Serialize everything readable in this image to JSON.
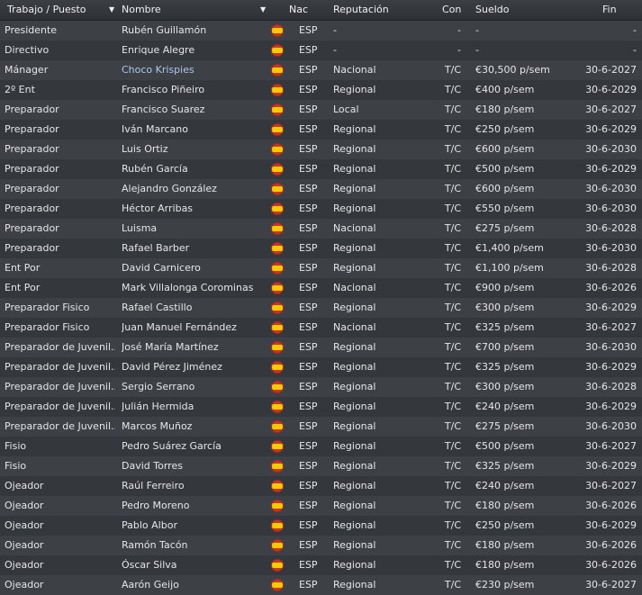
{
  "header": {
    "job": "Trabajo / Puesto",
    "name": "Nombre",
    "nac": "Nac",
    "rep": "Reputación",
    "con": "Con",
    "sal": "Sueldo",
    "fin": "Fin"
  },
  "rows": [
    {
      "job": "Presidente",
      "name": "Rubén Guillamón",
      "nac": "ESP",
      "rep": "-",
      "con": "-",
      "sal": "-",
      "fin": "-"
    },
    {
      "job": "Directivo",
      "name": "Enrique Alegre",
      "nac": "ESP",
      "rep": "-",
      "con": "-",
      "sal": "-",
      "fin": "-"
    },
    {
      "job": "Mánager",
      "name": "Choco Krispies",
      "nac": "ESP",
      "rep": "Nacional",
      "con": "T/C",
      "sal": "€30,500 p/sem",
      "fin": "30-6-2027",
      "link": true
    },
    {
      "job": "2º Ent",
      "name": "Francisco Piñeiro",
      "nac": "ESP",
      "rep": "Regional",
      "con": "T/C",
      "sal": "€400 p/sem",
      "fin": "30-6-2029"
    },
    {
      "job": "Preparador",
      "name": "Francisco Suarez",
      "nac": "ESP",
      "rep": "Local",
      "con": "T/C",
      "sal": "€180 p/sem",
      "fin": "30-6-2027"
    },
    {
      "job": "Preparador",
      "name": "Iván Marcano",
      "nac": "ESP",
      "rep": "Regional",
      "con": "T/C",
      "sal": "€250 p/sem",
      "fin": "30-6-2029"
    },
    {
      "job": "Preparador",
      "name": "Luis Ortiz",
      "nac": "ESP",
      "rep": "Regional",
      "con": "T/C",
      "sal": "€600 p/sem",
      "fin": "30-6-2030"
    },
    {
      "job": "Preparador",
      "name": "Rubén García",
      "nac": "ESP",
      "rep": "Regional",
      "con": "T/C",
      "sal": "€500 p/sem",
      "fin": "30-6-2029"
    },
    {
      "job": "Preparador",
      "name": "Alejandro González",
      "nac": "ESP",
      "rep": "Regional",
      "con": "T/C",
      "sal": "€600 p/sem",
      "fin": "30-6-2030"
    },
    {
      "job": "Preparador",
      "name": "Héctor Arribas",
      "nac": "ESP",
      "rep": "Regional",
      "con": "T/C",
      "sal": "€550 p/sem",
      "fin": "30-6-2030"
    },
    {
      "job": "Preparador",
      "name": "Luisma",
      "nac": "ESP",
      "rep": "Nacional",
      "con": "T/C",
      "sal": "€275 p/sem",
      "fin": "30-6-2028"
    },
    {
      "job": "Preparador",
      "name": "Rafael Barber",
      "nac": "ESP",
      "rep": "Regional",
      "con": "T/C",
      "sal": "€1,400 p/sem",
      "fin": "30-6-2030"
    },
    {
      "job": "Ent Por",
      "name": "David Carnicero",
      "nac": "ESP",
      "rep": "Regional",
      "con": "T/C",
      "sal": "€1,100 p/sem",
      "fin": "30-6-2028"
    },
    {
      "job": "Ent Por",
      "name": "Mark Villalonga Corominas",
      "nac": "ESP",
      "rep": "Nacional",
      "con": "T/C",
      "sal": "€900 p/sem",
      "fin": "30-6-2026"
    },
    {
      "job": "Preparador Fisico",
      "name": "Rafael Castillo",
      "nac": "ESP",
      "rep": "Regional",
      "con": "T/C",
      "sal": "€300 p/sem",
      "fin": "30-6-2029"
    },
    {
      "job": "Preparador Fisico",
      "name": "Juan Manuel Fernández",
      "nac": "ESP",
      "rep": "Nacional",
      "con": "T/C",
      "sal": "€325 p/sem",
      "fin": "30-6-2027"
    },
    {
      "job": "Preparador de Juvenil...",
      "name": "José María Martínez",
      "nac": "ESP",
      "rep": "Regional",
      "con": "T/C",
      "sal": "€700 p/sem",
      "fin": "30-6-2030"
    },
    {
      "job": "Preparador de Juvenil...",
      "name": "David Pérez Jiménez",
      "nac": "ESP",
      "rep": "Regional",
      "con": "T/C",
      "sal": "€325 p/sem",
      "fin": "30-6-2029"
    },
    {
      "job": "Preparador de Juvenil...",
      "name": "Sergio Serrano",
      "nac": "ESP",
      "rep": "Regional",
      "con": "T/C",
      "sal": "€300 p/sem",
      "fin": "30-6-2028"
    },
    {
      "job": "Preparador de Juvenil...",
      "name": "Julián Hermida",
      "nac": "ESP",
      "rep": "Regional",
      "con": "T/C",
      "sal": "€240 p/sem",
      "fin": "30-6-2029"
    },
    {
      "job": "Preparador de Juvenil...",
      "name": "Marcos Muñoz",
      "nac": "ESP",
      "rep": "Regional",
      "con": "T/C",
      "sal": "€275 p/sem",
      "fin": "30-6-2030"
    },
    {
      "job": "Fisio",
      "name": "Pedro Suárez García",
      "nac": "ESP",
      "rep": "Regional",
      "con": "T/C",
      "sal": "€500 p/sem",
      "fin": "30-6-2027"
    },
    {
      "job": "Fisio",
      "name": "David Torres",
      "nac": "ESP",
      "rep": "Regional",
      "con": "T/C",
      "sal": "€325 p/sem",
      "fin": "30-6-2029"
    },
    {
      "job": "Ojeador",
      "name": "Raúl Ferreiro",
      "nac": "ESP",
      "rep": "Regional",
      "con": "T/C",
      "sal": "€240 p/sem",
      "fin": "30-6-2027"
    },
    {
      "job": "Ojeador",
      "name": "Pedro Moreno",
      "nac": "ESP",
      "rep": "Regional",
      "con": "T/C",
      "sal": "€180 p/sem",
      "fin": "30-6-2026"
    },
    {
      "job": "Ojeador",
      "name": "Pablo Albor",
      "nac": "ESP",
      "rep": "Regional",
      "con": "T/C",
      "sal": "€250 p/sem",
      "fin": "30-6-2029"
    },
    {
      "job": "Ojeador",
      "name": "Ramón Tacón",
      "nac": "ESP",
      "rep": "Regional",
      "con": "T/C",
      "sal": "€180 p/sem",
      "fin": "30-6-2026"
    },
    {
      "job": "Ojeador",
      "name": "Óscar Silva",
      "nac": "ESP",
      "rep": "Regional",
      "con": "T/C",
      "sal": "€180 p/sem",
      "fin": "30-6-2026"
    },
    {
      "job": "Ojeador",
      "name": "Aarón Geijo",
      "nac": "ESP",
      "rep": "Regional",
      "con": "T/C",
      "sal": "€230 p/sem",
      "fin": "30-6-2027"
    }
  ],
  "flag_icon": "spain-flag-icon",
  "colors": {
    "link": "#a9c8f0",
    "flag_red": "#c0392b",
    "flag_yellow": "#f6c900"
  }
}
